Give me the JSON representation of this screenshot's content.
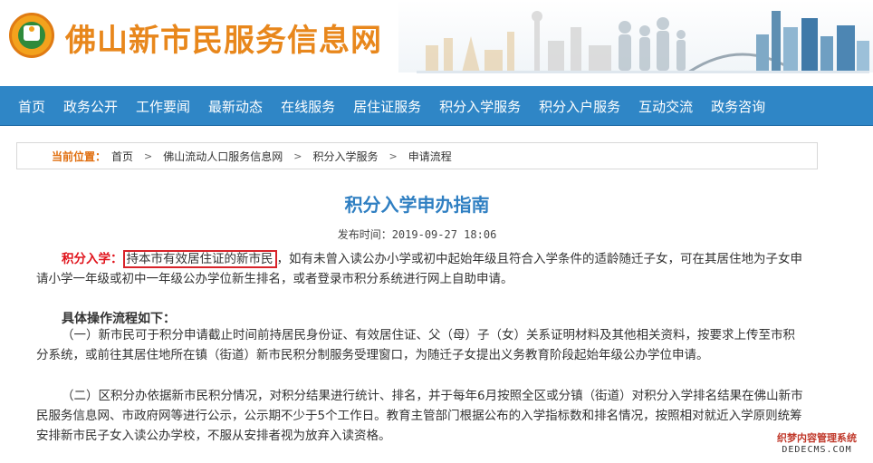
{
  "header": {
    "site_title": "佛山新市民服务信息网",
    "logo_icon": "foshan-citizen-logo-icon"
  },
  "nav": {
    "items": [
      {
        "label": "首页"
      },
      {
        "label": "政务公开"
      },
      {
        "label": "工作要闻"
      },
      {
        "label": "最新动态"
      },
      {
        "label": "在线服务"
      },
      {
        "label": "居住证服务"
      },
      {
        "label": "积分入学服务"
      },
      {
        "label": "积分入户服务"
      },
      {
        "label": "互动交流"
      },
      {
        "label": "政务咨询"
      }
    ],
    "bg_color": "#2f86c6"
  },
  "breadcrumb": {
    "current_label": "当前位置：",
    "items": [
      {
        "label": "首页"
      },
      {
        "label": "佛山流动人口服务信息网"
      },
      {
        "label": "积分入学服务"
      },
      {
        "label": "申请流程"
      }
    ]
  },
  "article": {
    "title": "积分入学申办指南",
    "publish_label": "发布时间：",
    "publish_time": "2019-09-27 18:06",
    "p1_label": "积分入学：",
    "p1_highlight": "持本市有效居住证的新市民",
    "p1_rest": "，如有未曾入读公办小学或初中起始年级且符合入学条件的适龄随迁子女，可在其居住地为子女申请小学一年级或初中一年级公办学位新生排名，或者登录市积分系统进行网上自助申请。",
    "sub_heading": "具体操作流程如下：",
    "p2": "（一）新市民可于积分申请截止时间前持居民身份证、有效居住证、父（母）子（女）关系证明材料及其他相关资料，按要求上传至市积分系统，或前往其居住地所在镇（街道）新市民积分制服务受理窗口，为随迁子女提出义务教育阶段起始年级公办学位申请。",
    "p3": "（二）区积分办依据新市民积分情况，对积分结果进行统计、排名，并于每年6月按照全区或分镇（街道）对积分入学排名结果在佛山新市民服务信息网、市政府网等进行公示，公示期不少于5个工作日。教育主管部门根据公布的入学指标数和排名情况，按照相对就近入学原则统筹安排新市民子女入读公办学校，不服从安排者视为放弃入读资格。"
  },
  "watermark": {
    "line1": "织梦内容管理系统",
    "line2": "DEDECMS.COM"
  },
  "colors": {
    "title_orange": "#e8871c",
    "article_title_blue": "#2f7fc2",
    "highlight_red": "#e0131b"
  }
}
